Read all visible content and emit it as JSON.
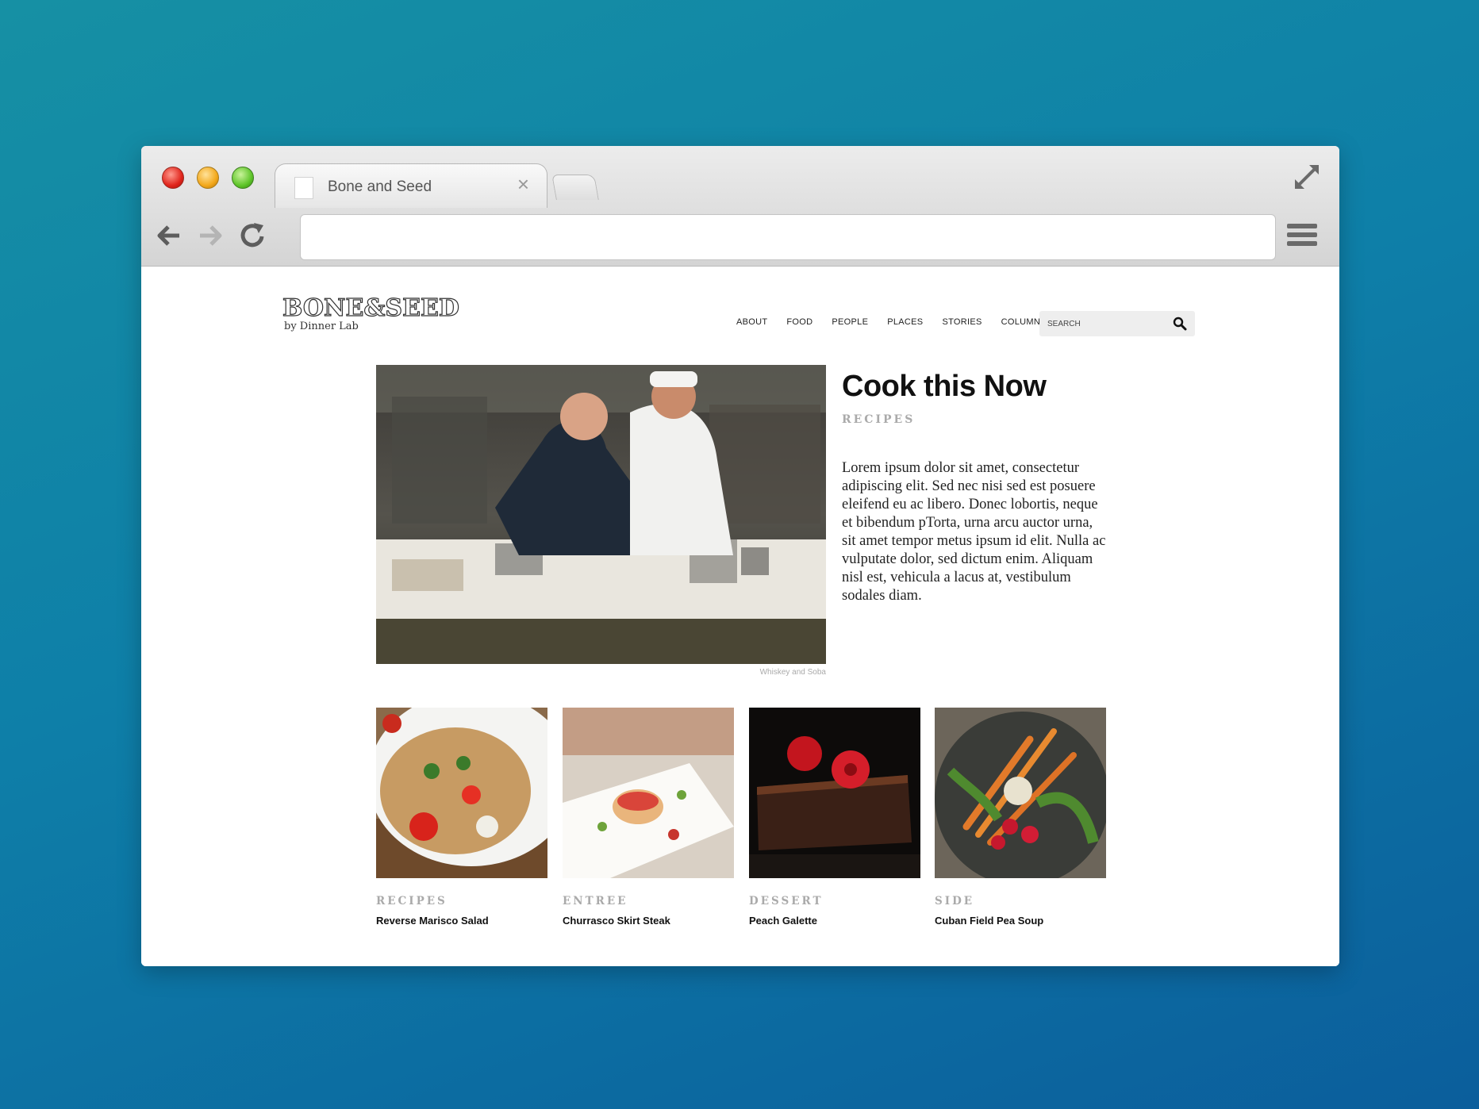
{
  "browser": {
    "tab_title": "Bone and Seed",
    "address_value": "",
    "icons": {
      "close": "close-icon",
      "back": "back-arrow-icon",
      "forward": "forward-arrow-icon",
      "reload": "reload-icon",
      "menu": "hamburger-menu-icon",
      "fullscreen": "fullscreen-icon"
    }
  },
  "site": {
    "logo_main": "BONE&SEED",
    "logo_sub": "by Dinner Lab",
    "nav": [
      "ABOUT",
      "FOOD",
      "PEOPLE",
      "PLACES",
      "STORIES",
      "COLUMNS"
    ],
    "search_placeholder": "SEARCH"
  },
  "hero": {
    "title": "Cook this Now",
    "category": "RECIPES",
    "body": "Lorem ipsum dolor sit amet, consectetur adipiscing elit. Sed nec nisi sed est posuere eleifend eu ac libero. Donec lobortis, neque et bibendum pTorta, urna arcu auctor urna, sit amet tempor metus ipsum id elit. Nulla ac vulputate dolor, sed dictum enim. Aliquam nisl est, vehicula a lacus at, vestibulum sodales diam.",
    "caption": "Whiskey and Soba"
  },
  "cards": [
    {
      "category": "RECIPES",
      "title": "Reverse Marisco Salad"
    },
    {
      "category": "ENTREE",
      "title": "Churrasco Skirt Steak"
    },
    {
      "category": "DESSERT",
      "title": "Peach Galette"
    },
    {
      "category": "SIDE",
      "title": "Cuban Field Pea Soup"
    }
  ],
  "colors": {
    "background_top": "#1690a4",
    "background_bottom": "#0b5e9c",
    "category_gray": "#aaaaaa"
  }
}
